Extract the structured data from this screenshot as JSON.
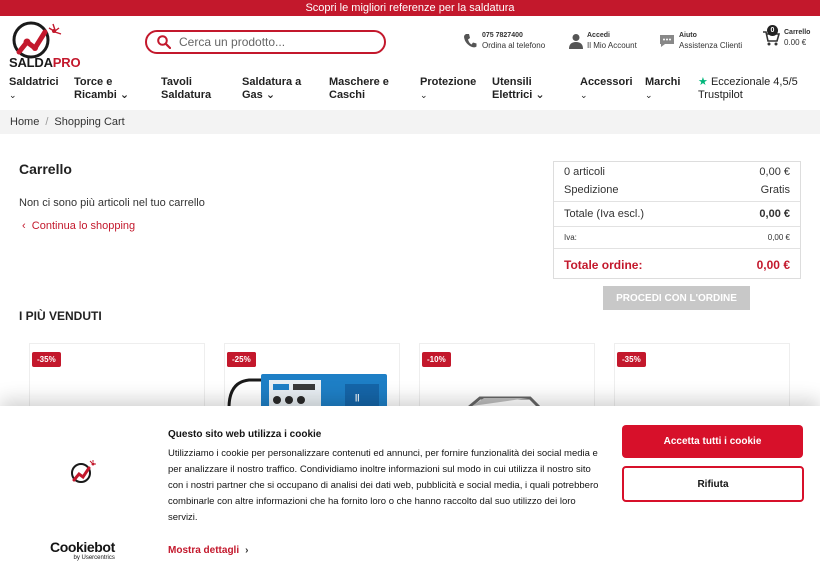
{
  "topbar": {
    "text": "Scopri le migliori referenze per la saldatura"
  },
  "logo": {
    "part1": "SALDA",
    "part2": "PRO"
  },
  "search": {
    "placeholder": "Cerca un prodotto..."
  },
  "header": {
    "phone": {
      "title": "075 7827400",
      "sub": "Ordina al telefono"
    },
    "account": {
      "title": "Accedi",
      "sub": "Il Mio Account"
    },
    "help": {
      "title": "Aiuto",
      "sub": "Assistenza Clienti"
    },
    "cart": {
      "title": "Carrello",
      "sub": "0.00 €",
      "count": "0"
    }
  },
  "nav": [
    {
      "line1": "Saldatrici",
      "line2": "⌄"
    },
    {
      "line1": "Torce e",
      "line2": "Ricambi ⌄"
    },
    {
      "line1": "Tavoli",
      "line2": "Saldatura"
    },
    {
      "line1": "Saldatura a",
      "line2": "Gas ⌄"
    },
    {
      "line1": "Maschere e",
      "line2": "Caschi"
    },
    {
      "line1": "Protezione",
      "line2": "⌄"
    },
    {
      "line1": "Utensili",
      "line2": "Elettrici ⌄"
    },
    {
      "line1": "Accessori",
      "line2": "⌄"
    },
    {
      "line1": "Marchi",
      "line2": "⌄"
    }
  ],
  "trustpilot": {
    "line1": "Eccezionale 4,5/5",
    "line2": "Trustpilot"
  },
  "breadcrumb": {
    "home": "Home",
    "sep": "/",
    "current": "Shopping Cart"
  },
  "cart": {
    "title": "Carrello",
    "empty": "Non ci sono più articoli nel tuo carrello",
    "continue": "Continua lo shopping"
  },
  "summary": {
    "items_label": "0 articoli",
    "items_value": "0,00 €",
    "shipping_label": "Spedizione",
    "shipping_value": "Gratis",
    "subtotal_label": "Totale (Iva escl.)",
    "subtotal_value": "0,00 €",
    "vat_label": "Iva:",
    "vat_value": "0,00 €",
    "total_label": "Totale ordine:",
    "total_value": "0,00 €",
    "proceed": "PROCEDI CON L'ORDINE"
  },
  "bestsellers": {
    "title": "I PIÙ VENDUTI",
    "badges": [
      "-35%",
      "-25%",
      "-10%",
      "-35%"
    ]
  },
  "cookie": {
    "title": "Questo sito web utilizza i cookie",
    "text": "Utilizziamo i cookie per personalizzare contenuti ed annunci, per fornire funzionalità dei social media e per analizzare il nostro traffico. Condividiamo inoltre informazioni sul modo in cui utilizza il nostro sito con i nostri partner che si occupano di analisi dei dati web, pubblicità e social media, i quali potrebbero combinarle con altre informazioni che ha fornito loro o che hanno raccolto dal suo utilizzo dei loro servizi.",
    "more": "Mostra dettagli",
    "accept": "Accetta tutti i cookie",
    "reject": "Rifiuta",
    "brand": "Cookiebot",
    "brand_sub": "by Usercentrics"
  },
  "colors": {
    "brand": "#c3182c",
    "accept": "#d7102a",
    "trust": "#00b67a"
  }
}
